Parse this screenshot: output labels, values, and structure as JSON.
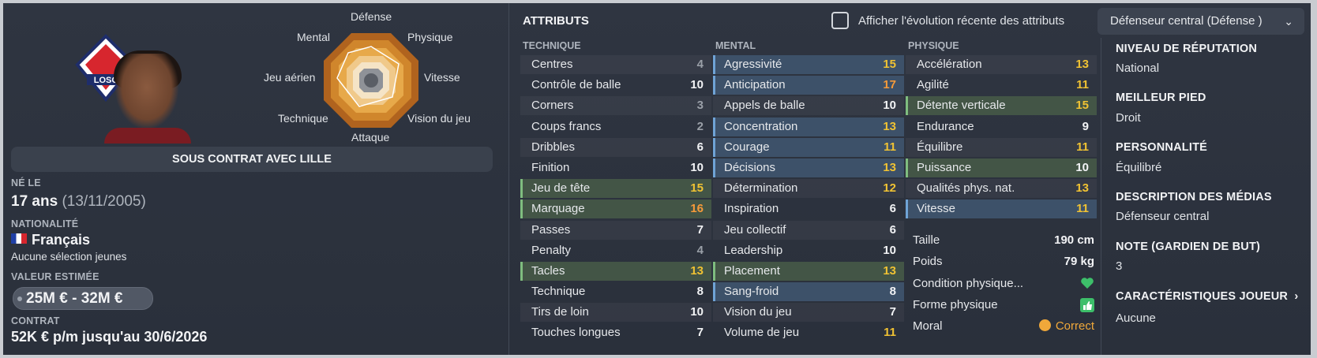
{
  "radar": {
    "labels": [
      "Défense",
      "Physique",
      "Vitesse",
      "Vision du jeu",
      "Attaque",
      "Technique",
      "Jeu aérien",
      "Mental"
    ]
  },
  "contract_banner": "SOUS CONTRAT AVEC LILLE",
  "born": {
    "label": "NÉ LE",
    "age": "17 ans",
    "date": "(13/11/2005)"
  },
  "nationality": {
    "label": "NATIONALITÉ",
    "country": "Français",
    "youth": "Aucune sélection jeunes"
  },
  "value": {
    "label": "VALEUR ESTIMÉE",
    "amount": "25M € - 32M €"
  },
  "contract": {
    "label": "CONTRAT",
    "text": "52K € p/m jusqu'au 30/6/2026"
  },
  "attributes": {
    "title": "ATTRIBUTS",
    "toggle_label": "Afficher l'évolution récente des attributs",
    "role": "Défenseur central (Défense )",
    "technique": {
      "header": "TECHNIQUE",
      "rows": [
        {
          "name": "Centres",
          "value": "4"
        },
        {
          "name": "Contrôle de balle",
          "value": "10"
        },
        {
          "name": "Corners",
          "value": "3"
        },
        {
          "name": "Coups francs",
          "value": "2"
        },
        {
          "name": "Dribbles",
          "value": "6"
        },
        {
          "name": "Finition",
          "value": "10"
        },
        {
          "name": "Jeu de tête",
          "value": "15"
        },
        {
          "name": "Marquage",
          "value": "16"
        },
        {
          "name": "Passes",
          "value": "7"
        },
        {
          "name": "Penalty",
          "value": "4"
        },
        {
          "name": "Tacles",
          "value": "13"
        },
        {
          "name": "Technique",
          "value": "8"
        },
        {
          "name": "Tirs de loin",
          "value": "10"
        },
        {
          "name": "Touches longues",
          "value": "7"
        }
      ]
    },
    "mental": {
      "header": "MENTAL",
      "rows": [
        {
          "name": "Agressivité",
          "value": "15"
        },
        {
          "name": "Anticipation",
          "value": "17"
        },
        {
          "name": "Appels de balle",
          "value": "10"
        },
        {
          "name": "Concentration",
          "value": "13"
        },
        {
          "name": "Courage",
          "value": "11"
        },
        {
          "name": "Décisions",
          "value": "13"
        },
        {
          "name": "Détermination",
          "value": "12"
        },
        {
          "name": "Inspiration",
          "value": "6"
        },
        {
          "name": "Jeu collectif",
          "value": "6"
        },
        {
          "name": "Leadership",
          "value": "10"
        },
        {
          "name": "Placement",
          "value": "13"
        },
        {
          "name": "Sang-froid",
          "value": "8"
        },
        {
          "name": "Vision du jeu",
          "value": "7"
        },
        {
          "name": "Volume de jeu",
          "value": "11"
        }
      ]
    },
    "physique": {
      "header": "PHYSIQUE",
      "rows": [
        {
          "name": "Accélération",
          "value": "13"
        },
        {
          "name": "Agilité",
          "value": "11"
        },
        {
          "name": "Détente verticale",
          "value": "15"
        },
        {
          "name": "Endurance",
          "value": "9"
        },
        {
          "name": "Équilibre",
          "value": "11"
        },
        {
          "name": "Puissance",
          "value": "10"
        },
        {
          "name": "Qualités phys. nat.",
          "value": "13"
        },
        {
          "name": "Vitesse",
          "value": "11"
        }
      ]
    },
    "extra": {
      "height_label": "Taille",
      "height": "190 cm",
      "weight_label": "Poids",
      "weight": "79 kg",
      "condition_label": "Condition physique...",
      "fitness_label": "Forme physique",
      "morale_label": "Moral",
      "morale": "Correct"
    }
  },
  "side": {
    "reputation_label": "NIVEAU DE RÉPUTATION",
    "reputation": "National",
    "foot_label": "MEILLEUR PIED",
    "foot": "Droit",
    "personality_label": "PERSONNALITÉ",
    "personality": "Équilibré",
    "media_label": "DESCRIPTION DES MÉDIAS",
    "media": "Défenseur central",
    "gk_label": "NOTE (GARDIEN DE BUT)",
    "gk": "3",
    "traits_label": "CARACTÉRISTIQUES JOUEUR",
    "traits": "Aucune"
  },
  "colors": {
    "panel": "#2d333e",
    "highlight_blue": "#3d5169",
    "highlight_green": "#435546",
    "value_good": "#f0c233",
    "value_high": "#f59a3a",
    "value_low": "#9aa0a8"
  }
}
